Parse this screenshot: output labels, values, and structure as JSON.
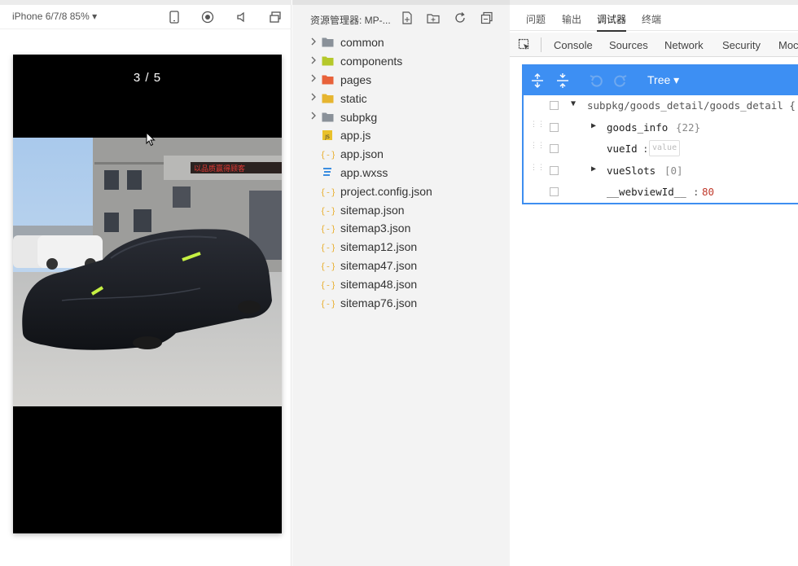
{
  "simulator": {
    "device_label": "iPhone 6/7/8 85% ▾",
    "page_indicator": "3 / 5",
    "icons": [
      "phone-icon",
      "record-icon",
      "volume-icon",
      "window-icon"
    ]
  },
  "explorer": {
    "title": "资源管理器: MP-...",
    "icons": [
      "new-file-icon",
      "new-folder-icon",
      "refresh-icon",
      "collapse-icon"
    ],
    "items": [
      {
        "name": "common",
        "type": "folder",
        "color": "#8a9199",
        "expandable": true
      },
      {
        "name": "components",
        "type": "folder",
        "color": "#b5c82a",
        "expandable": true
      },
      {
        "name": "pages",
        "type": "folder",
        "color": "#e8623a",
        "expandable": true
      },
      {
        "name": "static",
        "type": "folder",
        "color": "#e6b530",
        "expandable": true
      },
      {
        "name": "subpkg",
        "type": "folder",
        "color": "#8a9199",
        "expandable": true
      },
      {
        "name": "app.js",
        "type": "js",
        "color": "#e9c12b",
        "expandable": false
      },
      {
        "name": "app.json",
        "type": "json",
        "color": "#e9b23a",
        "expandable": false
      },
      {
        "name": "app.wxss",
        "type": "css",
        "color": "#3b8de0",
        "expandable": false
      },
      {
        "name": "project.config.json",
        "type": "json",
        "color": "#e9b23a",
        "expandable": false
      },
      {
        "name": "sitemap.json",
        "type": "json",
        "color": "#e9b23a",
        "expandable": false
      },
      {
        "name": "sitemap3.json",
        "type": "json",
        "color": "#e9b23a",
        "expandable": false
      },
      {
        "name": "sitemap12.json",
        "type": "json",
        "color": "#e9b23a",
        "expandable": false
      },
      {
        "name": "sitemap47.json",
        "type": "json",
        "color": "#e9b23a",
        "expandable": false
      },
      {
        "name": "sitemap48.json",
        "type": "json",
        "color": "#e9b23a",
        "expandable": false
      },
      {
        "name": "sitemap76.json",
        "type": "json",
        "color": "#e9b23a",
        "expandable": false
      }
    ]
  },
  "devtools": {
    "panel_tabs": [
      "问题",
      "输出",
      "调试器",
      "终端"
    ],
    "active_panel_tab": "调试器",
    "tabs": [
      "Console",
      "Sources",
      "Network",
      "Security",
      "Moc"
    ],
    "appdata": {
      "mode": "Tree ▾",
      "root_path": "subpkg/goods_detail/goods_detail {",
      "rows": [
        {
          "key": "goods_info",
          "value": "{22}",
          "expandable": true
        },
        {
          "key": "vueId",
          "colon": ":",
          "placeholder": "value",
          "expandable": false
        },
        {
          "key": "vueSlots",
          "value": "[0]",
          "expandable": true
        },
        {
          "key": "__webviewId__",
          "colon": ":",
          "value": "80",
          "expandable": false
        }
      ]
    }
  },
  "colors": {
    "accent_blue": "#3d8ff3",
    "number_red": "#c0392b",
    "explorer_bg": "#f3f3f3"
  }
}
